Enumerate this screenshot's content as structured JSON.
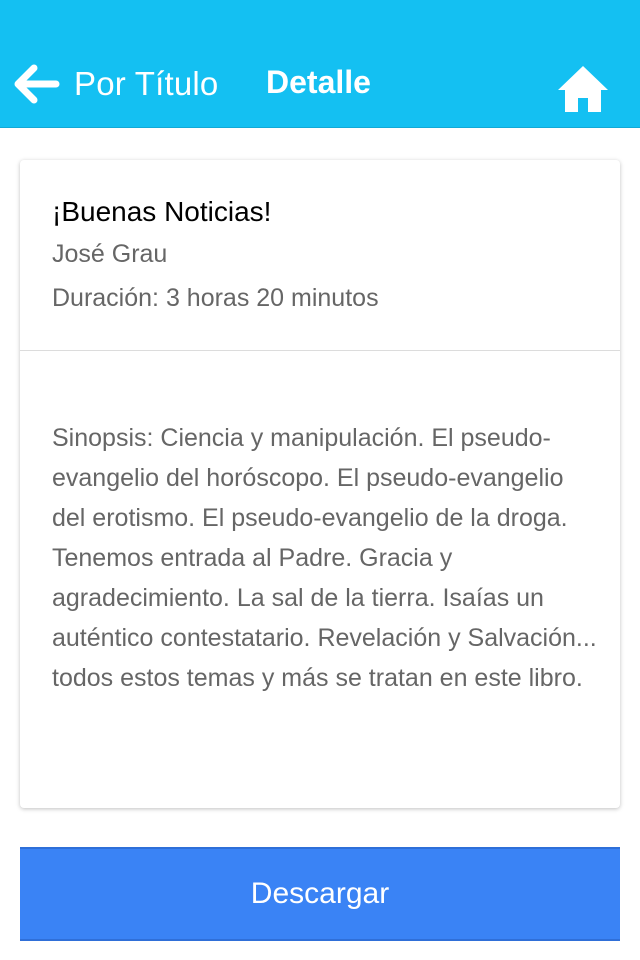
{
  "header": {
    "back_label": "Por Título",
    "title": "Detalle",
    "back_icon": "arrow-left-icon",
    "home_icon": "home-icon"
  },
  "book": {
    "title": "¡Buenas Noticias!",
    "author": "José Grau",
    "duration": "Duración: 3 horas 20 minutos",
    "synopsis": "Sinopsis: Ciencia y manipulación. El pseudo-evangelio del horóscopo. El pseudo-evangelio del erotismo. El pseudo-evangelio de la droga. Tenemos entrada al Padre. Gracia y agradecimiento. La sal de la tierra. Isaías un auténtico contestatario. Revelación y Salvación... todos estos temas y más se tratan en este libro."
  },
  "actions": {
    "download_label": "Descargar"
  },
  "colors": {
    "header_bg": "#14c0f2",
    "button_bg": "#3a83f5",
    "text_primary": "#000000",
    "text_secondary": "#666666"
  }
}
